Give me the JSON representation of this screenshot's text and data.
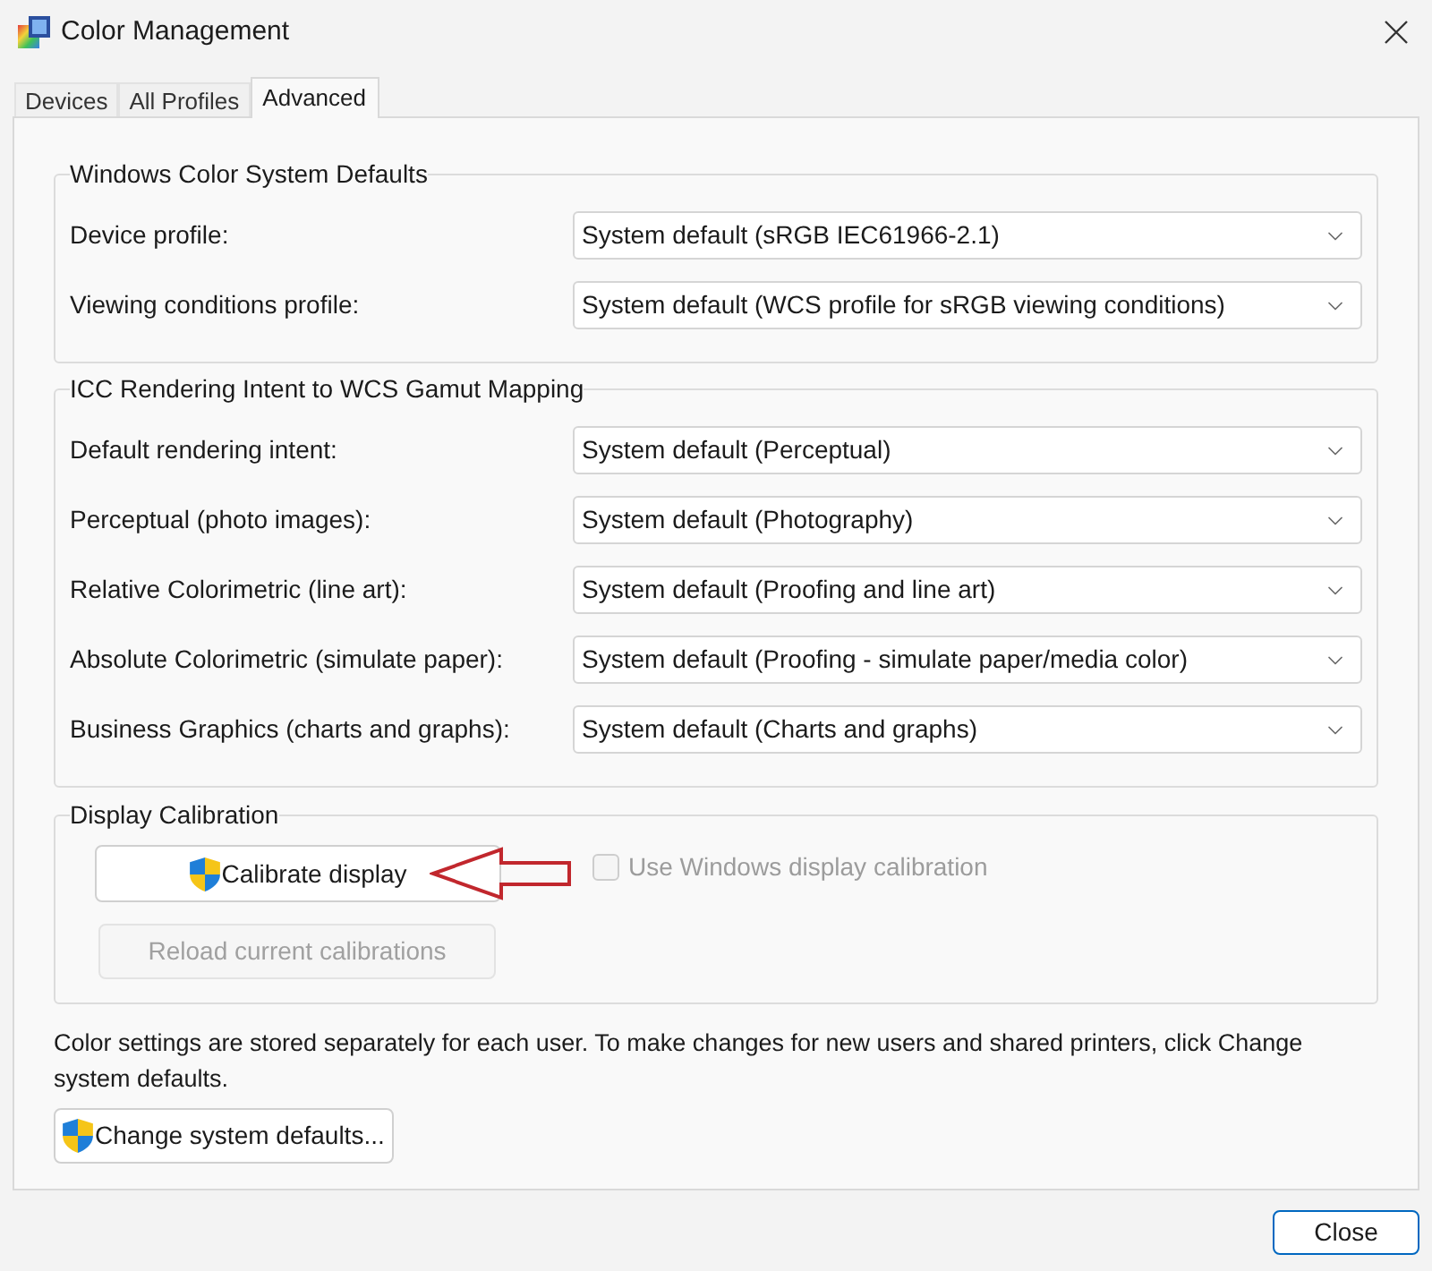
{
  "window": {
    "title": "Color Management"
  },
  "tabs": [
    {
      "label": "Devices",
      "selected": false
    },
    {
      "label": "All Profiles",
      "selected": false
    },
    {
      "label": "Advanced",
      "selected": true
    }
  ],
  "groups": [
    {
      "title": "Windows Color System Defaults",
      "rows": [
        {
          "label": "Device profile:",
          "value": "System default (sRGB IEC61966-2.1)"
        },
        {
          "label": "Viewing conditions profile:",
          "value": "System default (WCS profile for sRGB viewing conditions)"
        }
      ]
    },
    {
      "title": "ICC Rendering Intent to WCS Gamut Mapping",
      "rows": [
        {
          "label": "Default rendering intent:",
          "value": "System default (Perceptual)"
        },
        {
          "label": "Perceptual (photo images):",
          "value": "System default (Photography)"
        },
        {
          "label": "Relative Colorimetric (line art):",
          "value": "System default (Proofing and line art)"
        },
        {
          "label": "Absolute Colorimetric (simulate paper):",
          "value": "System default (Proofing - simulate paper/media color)"
        },
        {
          "label": "Business Graphics (charts and graphs):",
          "value": "System default (Charts and graphs)"
        }
      ]
    }
  ],
  "display_calibration": {
    "title": "Display Calibration",
    "calibrate_button": "Calibrate display",
    "use_windows_calibration": {
      "label": "Use Windows display calibration",
      "checked": false,
      "disabled": true
    },
    "reload_button": {
      "label": "Reload current calibrations",
      "disabled": true
    }
  },
  "note": "Color settings are stored separately for each user. To make changes for new users and shared printers, click Change system defaults.",
  "change_defaults_button": "Change system defaults...",
  "close_button": "Close"
}
